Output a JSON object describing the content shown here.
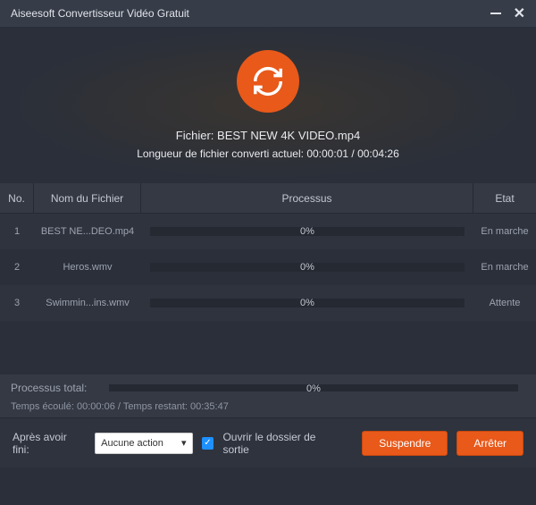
{
  "title": "Aiseesoft Convertisseur Vidéo Gratuit",
  "hero": {
    "file_label": "Fichier:",
    "file_name": "BEST NEW 4K VIDEO.mp4",
    "len_label": "Longueur de fichier converti actuel:",
    "elapsed": "00:00:01",
    "total": "00:04:26"
  },
  "headers": {
    "no": "No.",
    "name": "Nom du Fichier",
    "proc": "Processus",
    "stat": "Etat"
  },
  "rows": [
    {
      "no": "1",
      "name": "BEST NE...DEO.mp4",
      "pct": "0%",
      "stat": "En marche"
    },
    {
      "no": "2",
      "name": "Heros.wmv",
      "pct": "0%",
      "stat": "En marche"
    },
    {
      "no": "3",
      "name": "Swimmin...ins.wmv",
      "pct": "0%",
      "stat": "Attente"
    }
  ],
  "total": {
    "label": "Processus total:",
    "pct": "0%",
    "time_elapsed_label": "Temps écoulé:",
    "time_elapsed": "00:00:06",
    "time_remaining_label": "Temps restant:",
    "time_remaining": "00:35:47"
  },
  "footer": {
    "after_label": "Après avoir fini:",
    "select_value": "Aucune action",
    "open_folder": "Ouvrir le dossier de sortie",
    "suspend": "Suspendre",
    "stop": "Arrêter"
  }
}
